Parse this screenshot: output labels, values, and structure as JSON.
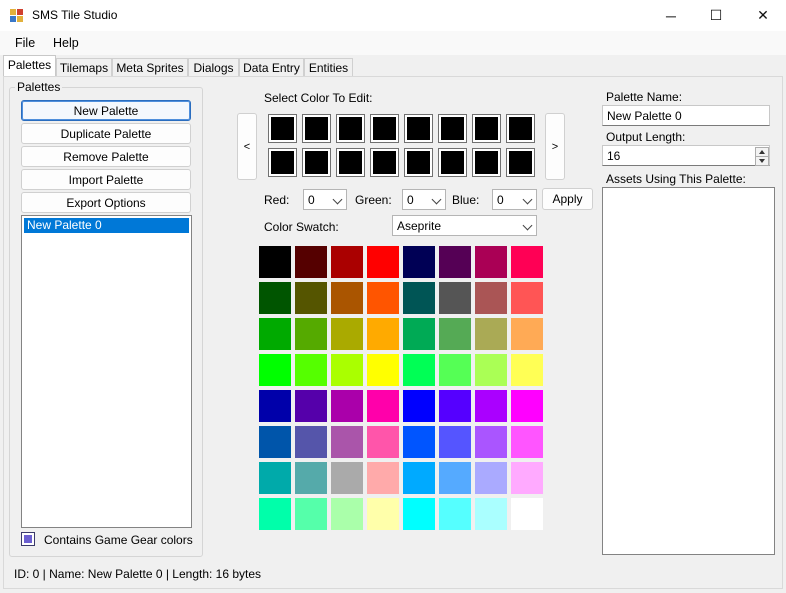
{
  "window": {
    "title": "SMS Tile Studio",
    "controls": {
      "minimize": "─",
      "maximize": "☐",
      "close": "✕"
    }
  },
  "menu": [
    "File",
    "Help"
  ],
  "tabs": [
    "Palettes",
    "Tilemaps",
    "Meta Sprites",
    "Dialogs",
    "Data Entry",
    "Entities"
  ],
  "palettes_group": {
    "legend": "Palettes",
    "buttons": {
      "new": "New Palette",
      "duplicate": "Duplicate Palette",
      "remove": "Remove Palette",
      "import": "Import Palette",
      "export": "Export Options"
    },
    "list": [
      "New Palette 0"
    ],
    "game_gear_label": "Contains Game Gear colors"
  },
  "editor": {
    "select_color_label": "Select Color To Edit:",
    "prev": "<",
    "next": ">",
    "red_label": "Red:",
    "red_value": "0",
    "green_label": "Green:",
    "green_value": "0",
    "blue_label": "Blue:",
    "blue_value": "0",
    "apply": "Apply",
    "swatch_label": "Color Swatch:",
    "swatch_value": "Aseprite",
    "palette_cells_color": "#000000"
  },
  "swatch_colors": [
    [
      "#000000",
      "#550000",
      "#aa0000",
      "#ff0000",
      "#000055",
      "#550055",
      "#aa0055",
      "#ff0055"
    ],
    [
      "#005500",
      "#555500",
      "#aa5500",
      "#ff5500",
      "#005555",
      "#555555",
      "#aa5555",
      "#ff5555"
    ],
    [
      "#00aa00",
      "#55aa00",
      "#aaaa00",
      "#ffaa00",
      "#00aa55",
      "#55aa55",
      "#aaaa55",
      "#ffaa55"
    ],
    [
      "#00ff00",
      "#55ff00",
      "#aaff00",
      "#ffff00",
      "#00ff55",
      "#55ff55",
      "#aaff55",
      "#ffff55"
    ],
    [
      "#0000aa",
      "#5500aa",
      "#aa00aa",
      "#ff00aa",
      "#0000ff",
      "#5500ff",
      "#aa00ff",
      "#ff00ff"
    ],
    [
      "#0055aa",
      "#5555aa",
      "#aa55aa",
      "#ff55aa",
      "#0055ff",
      "#5555ff",
      "#aa55ff",
      "#ff55ff"
    ],
    [
      "#00aaaa",
      "#55aaaa",
      "#aaaaaa",
      "#ffaaaa",
      "#00aaff",
      "#55aaff",
      "#aaaaff",
      "#ffaaff"
    ],
    [
      "#00ffaa",
      "#55ffaa",
      "#aaffaa",
      "#ffffaa",
      "#00ffff",
      "#55ffff",
      "#aaffff",
      "#ffffff"
    ]
  ],
  "right_panel": {
    "name_label": "Palette Name:",
    "name_value": "New Palette 0",
    "length_label": "Output Length:",
    "length_value": "16",
    "assets_label": "Assets Using This Palette:"
  },
  "status": "ID: 0 | Name: New Palette 0 | Length: 16 bytes"
}
